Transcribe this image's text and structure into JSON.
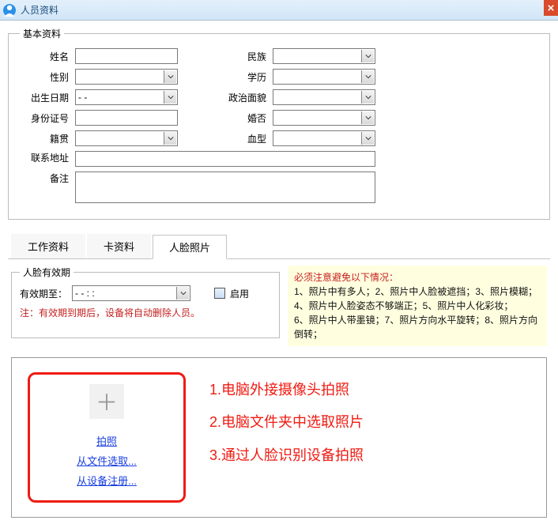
{
  "window": {
    "title": "人员资料"
  },
  "basic": {
    "legend": "基本资料",
    "labels": {
      "name": "姓名",
      "gender": "性别",
      "birth": "出生日期",
      "idno": "身份证号",
      "native": "籍贯",
      "ethnic": "民族",
      "edu": "学历",
      "politics": "政治面貌",
      "marriage": "婚否",
      "blood": "血型",
      "addr": "联系地址",
      "remark": "备注"
    },
    "values": {
      "name": "",
      "gender": "",
      "birth": "-   -",
      "idno": "",
      "native": "",
      "ethnic": "",
      "edu": "",
      "politics": "",
      "marriage": "",
      "blood": "",
      "addr": "",
      "remark": ""
    }
  },
  "tabs": {
    "work": "工作资料",
    "card": "卡资料",
    "face": "人脸照片",
    "active": "face"
  },
  "validity": {
    "legend": "人脸有效期",
    "until_label": "有效期至：",
    "until_value": "-   -          :    :",
    "enable_label": "启用",
    "note": "注：有效期到期后，设备将自动删除人员。"
  },
  "warnings": {
    "head": "必须注意避免以下情况：",
    "lines": [
      "1、照片中有多人；2、照片中人脸被遮挡；3、照片模糊；",
      "4、照片中人脸姿态不够端正；5、照片中人化彩妆；",
      "6、照片中人带墨镜；7、照片方向水平旋转；8、照片方向倒转；"
    ]
  },
  "photo": {
    "links": {
      "shoot": "拍照",
      "file": "从文件选取...",
      "device": "从设备注册..."
    },
    "notes": [
      "1.电脑外接摄像头拍照",
      "2.电脑文件夹中选取照片",
      "3.通过人脸识别设备拍照"
    ]
  }
}
